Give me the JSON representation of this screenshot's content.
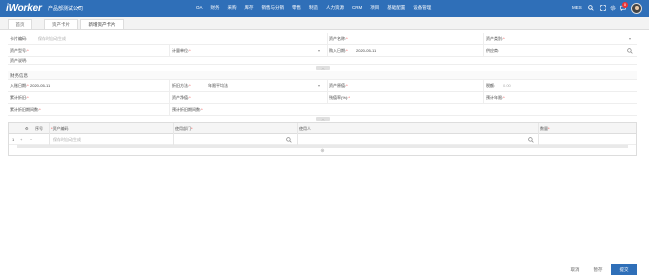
{
  "app": {
    "logo": "iWorker",
    "company": "产品部测试公司",
    "nav": [
      "OA",
      "财务",
      "采购",
      "库存",
      "销售与分销",
      "零售",
      "制造",
      "人力资源",
      "CRM",
      "项目",
      "基础配置",
      "设备管理"
    ],
    "user": "MES",
    "notification_count": "8"
  },
  "tabs": [
    "首页",
    "资产卡片",
    "新增资产卡片"
  ],
  "form": {
    "card_code_label": "卡片编码:",
    "card_code_placeholder": "保存时自动生成",
    "asset_name_label": "资产名称:",
    "asset_category_label": "资产类别:",
    "asset_model_label": "资产型号:",
    "unit_label": "计量单位:",
    "purchase_date_label": "购入日期:",
    "purchase_date_value": "2020-05-11",
    "supplier_label": "供应商:",
    "asset_desc_label": "资产说明:",
    "finance_section": "财务信息",
    "entry_date_label": "入账日期:",
    "entry_date_value": "2020-05-11",
    "depreciation_method_label": "折旧方法:",
    "depreciation_method_value": "年限平均法",
    "asset_original_value_label": "资产原值:",
    "tax_label": "税额:",
    "tax_placeholder": "0.00",
    "accum_depr_label": "累计折旧:",
    "asset_net_value_label": "资产净值:",
    "salvage_rate_label": "残值率(%):",
    "expected_life_label": "预计年限:",
    "accum_depr_months_label": "累计折旧期间数:",
    "expected_depr_months_label": "预计折旧期间数:"
  },
  "table": {
    "headers": {
      "seq": "序号",
      "asset_code": "资产编码",
      "use_dept": "使用部门",
      "user": "使用人",
      "quantity": "数量"
    },
    "row": {
      "index": "1",
      "asset_code_placeholder": "保存时自动生成"
    }
  },
  "actions": {
    "cancel": "取消",
    "draft": "暂存",
    "submit": "提交"
  }
}
